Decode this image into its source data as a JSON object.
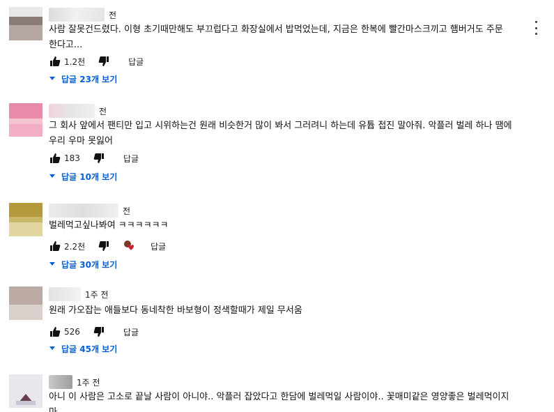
{
  "comments": [
    {
      "time": "전",
      "text": "사람 잘못건드렸다. 이형 초기때만해도 부끄럽다고 화장실에서 밥먹었는데, 지금은 한복에 빨간마스크끼고 햄버거도 주문\n한다고...",
      "likes": "1.2천",
      "reply_label": "답글",
      "replies_label": "답글 23개 보기",
      "avatar_colors": [
        "#8a7d78",
        "#b5a8a2"
      ]
    },
    {
      "time": "전",
      "text": "그 회사 앞에서 팬티만 입고 시위하는건 원래 비슷한거 많이 봐서 그러려니 하는데 유튭 접진 말아줘. 악플러 벌레 하나 땜에\n우리 우마 못잃어",
      "likes": "183",
      "reply_label": "답글",
      "replies_label": "답글 10개 보기",
      "avatar_colors": [
        "#e98aa8",
        "#f6c3d0"
      ]
    },
    {
      "time": "전",
      "text": "벌레먹고싶나봐여 ㅋㅋㅋㅋㅋㅋ",
      "likes": "2.2천",
      "reply_label": "답글",
      "replies_label": "답글 30개 보기",
      "avatar_colors": [
        "#b49a3c",
        "#e2d6a0"
      ]
    },
    {
      "time": "1주 전",
      "text": "원래 가오잡는 애들보다 동네착한 바보형이 정색할때가 제일 무서움",
      "likes": "526",
      "reply_label": "답글",
      "replies_label": "답글 45개 보기",
      "avatar_colors": [
        "#bcaaa4",
        "#d9cfcb"
      ]
    },
    {
      "time": "1주 전",
      "text": "아니 이 사람은 고소로 끝날 사람이 아니야.. 악플러 잡았다고 한담에 벌레먹일 사람이야.. 꽃매미같은 영양좋은 벌레먹이지\n마.",
      "avatar_colors": [
        "#e9e7ee",
        "#c8c6d4"
      ]
    }
  ],
  "icons": {
    "like": "thumbs-up-icon",
    "dislike": "thumbs-down-icon",
    "expand": "caret-down-icon",
    "menu": "more-vert-icon",
    "heart": "creator-heart-icon"
  },
  "colors": {
    "link": "#065fd4",
    "text": "#111111"
  }
}
